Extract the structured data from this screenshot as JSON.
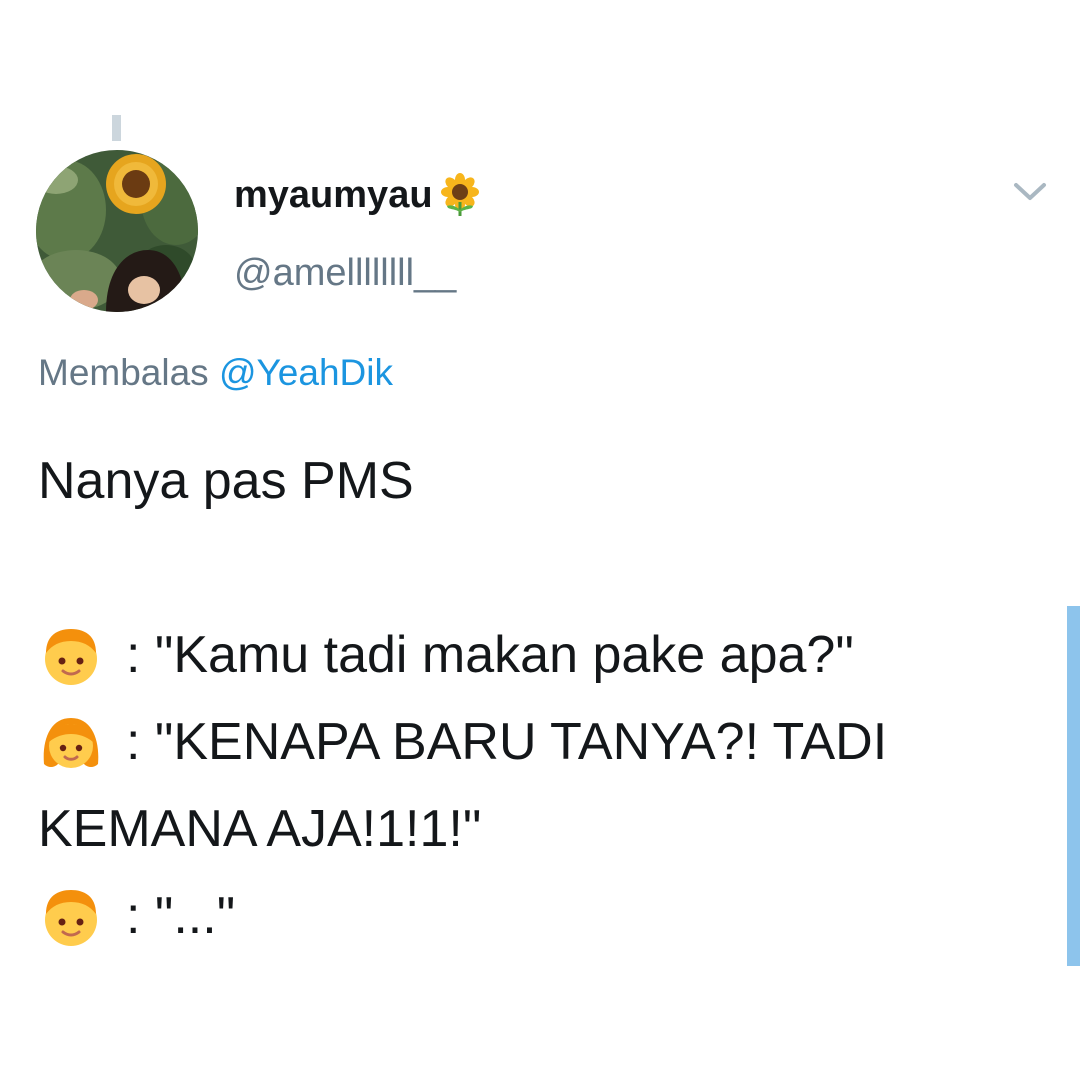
{
  "tweet": {
    "display_name": "myaumyau",
    "display_name_emoji": "sunflower",
    "handle": "@amellllllll__",
    "reply_prefix": "Membalas",
    "reply_to": "@YeahDik",
    "lines": [
      {
        "emoji": null,
        "text": "Nanya pas PMS"
      },
      {
        "emoji": "boy",
        "text": ": \"Kamu tadi makan pake apa?\""
      },
      {
        "emoji": "girl",
        "text": ": \"KENAPA BARU TANYA?! TADI"
      },
      {
        "emoji": null,
        "text": "KEMANA AJA!1!1!\""
      },
      {
        "emoji": "boy",
        "text": ": \"...\""
      }
    ]
  },
  "icons": {
    "menu": "chevron-down-icon",
    "name_emoji": "sunflower-icon",
    "speaker_1": "boy-emoji-icon",
    "speaker_2": "girl-emoji-icon"
  },
  "colors": {
    "text": "#14171a",
    "secondary": "#657786",
    "link": "#1b95e0",
    "thread_line": "#ccd6dd",
    "scroll_indicator": "#8dc4ec"
  }
}
